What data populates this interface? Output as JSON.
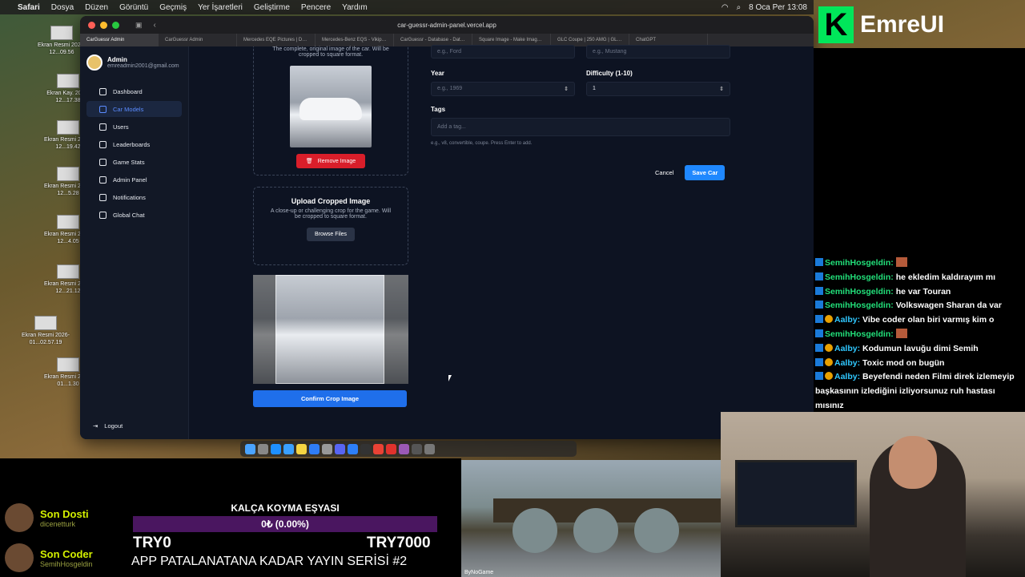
{
  "menubar": {
    "app": "Safari",
    "items": [
      "Dosya",
      "Düzen",
      "Görüntü",
      "Geçmiş",
      "Yer İşaretleri",
      "Geliştirme",
      "Pencere",
      "Yardım"
    ],
    "clock": "8 Oca Per 13:08"
  },
  "desktop": {
    "files": [
      {
        "label": "Ekran Resmi 2025-12...09.56"
      },
      {
        "label": "Ekran Kay. 2025-12...17.38"
      },
      {
        "label": "Ekran Resmi 2025-12...19.42"
      },
      {
        "label": "Ekran Resmi 2025-12...5.28"
      },
      {
        "label": "Ekran Resmi 2025-12...4.05"
      },
      {
        "label": "Ekran Resmi 2025-12...21.12"
      },
      {
        "label": "Ekran Resmi 2026-01...02.57.19"
      },
      {
        "label": "Ekran Resmi 2026-01...1.30"
      }
    ]
  },
  "browser": {
    "url": "car-guessr-admin-panel.vercel.app",
    "tabs": [
      {
        "label": "CarGuessr Admin",
        "active": true
      },
      {
        "label": "CarGuessr Admin"
      },
      {
        "label": "Mercedes EQE Pictures | Dow..."
      },
      {
        "label": "Mercedes-Benz EQS - Vikipedi"
      },
      {
        "label": "CarGuessr - Database - Data..."
      },
      {
        "label": "Square Image - Make Image S..."
      },
      {
        "label": "GLC Coupe | 250 AMG | GLC..."
      },
      {
        "label": "ChatGPT"
      }
    ]
  },
  "sidebar": {
    "user": {
      "name": "Admin",
      "email": "emreadmin2001@gmail.com"
    },
    "items": [
      {
        "label": "Dashboard",
        "icon": "dashboard-icon"
      },
      {
        "label": "Car Models",
        "icon": "car-icon",
        "active": true
      },
      {
        "label": "Users",
        "icon": "users-icon"
      },
      {
        "label": "Leaderboards",
        "icon": "trophy-icon"
      },
      {
        "label": "Game Stats",
        "icon": "chart-icon"
      },
      {
        "label": "Admin Panel",
        "icon": "shield-icon"
      },
      {
        "label": "Notifications",
        "icon": "bell-icon"
      },
      {
        "label": "Global Chat",
        "icon": "chat-icon"
      }
    ],
    "logout": "Logout"
  },
  "form": {
    "original_desc": "The complete, original image of the car. Will be cropped to square format.",
    "remove_image": "Remove Image",
    "upload_cropped_title": "Upload Cropped Image",
    "upload_cropped_desc": "A close-up or challenging crop for the game. Will be cropped to square format.",
    "browse_files": "Browse Files",
    "confirm_crop": "Confirm Crop Image",
    "brand_placeholder": "e.g., Ford",
    "model_placeholder": "e.g., Mustang",
    "year_label": "Year",
    "year_placeholder": "e.g., 1969",
    "difficulty_label": "Difficulty (1-10)",
    "difficulty_value": "1",
    "tags_label": "Tags",
    "tags_placeholder": "Add a tag...",
    "tags_hint": "e.g., v8, convertible, coupe. Press Enter to add.",
    "cancel": "Cancel",
    "save": "Save Car"
  },
  "overlay": {
    "brand": "EmreUI",
    "chat": [
      {
        "user": "SemihHosgeldin:",
        "msg": "",
        "type": "u1",
        "emote": true
      },
      {
        "user": "SemihHosgeldin:",
        "msg": "he ekledim kaldırayım mı",
        "type": "u1"
      },
      {
        "user": "SemihHosgeldin:",
        "msg": "he var Touran",
        "type": "u1"
      },
      {
        "user": "SemihHosgeldin:",
        "msg": "Volkswagen Sharan da var",
        "type": "u1"
      },
      {
        "user": "Aalby:",
        "msg": "Vibe coder olan biri varmış kim o",
        "type": "u2"
      },
      {
        "user": "SemihHosgeldin:",
        "msg": "",
        "type": "u1",
        "emote": true
      },
      {
        "user": "Aalby:",
        "msg": "Kodumun lavuğu dimi Semih",
        "type": "u2"
      },
      {
        "user": "Aalby:",
        "msg": "Toxic mod on bugün",
        "type": "u2"
      },
      {
        "user": "Aalby:",
        "msg": "Beyefendi neden Filmi direk izlemeyip başkasının izlediğini izliyorsunuz ruh hastası mısınız",
        "type": "u2"
      }
    ],
    "recent": [
      {
        "heading": "Son Dosti",
        "name": "dicenetturk"
      },
      {
        "heading": "Son Coder",
        "name": "SemihHosgeldin"
      }
    ],
    "goal": {
      "title": "KALÇA KOYMA EŞYASI",
      "progress_text": "0₺ (0.00%)",
      "progress": 0.0,
      "min": "TRY0",
      "max": "TRY7000"
    },
    "series_title": "APP PATALANATANA KADAR YAYIN SERİSİ #2",
    "video_watermark": "ByNoGame"
  }
}
